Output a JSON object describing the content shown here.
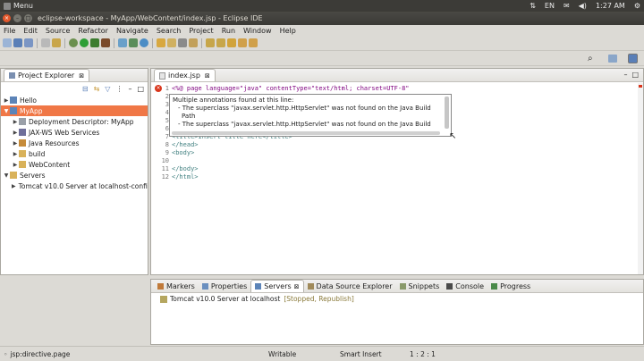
{
  "system": {
    "menu": "Menu",
    "keyboard": "EN",
    "clock": "1:27 AM"
  },
  "window": {
    "title": "eclipse-workspace - MyApp/WebContent/index.jsp - Eclipse IDE"
  },
  "menubar": [
    "File",
    "Edit",
    "Source",
    "Refactor",
    "Navigate",
    "Search",
    "Project",
    "Run",
    "Window",
    "Help"
  ],
  "explorer": {
    "tab": "Project Explorer",
    "items": [
      {
        "label": "Hello",
        "depth": 0,
        "expanded": false,
        "selected": false,
        "icon": "project-icon"
      },
      {
        "label": "MyApp",
        "depth": 0,
        "expanded": true,
        "selected": true,
        "icon": "project-icon"
      },
      {
        "label": "Deployment Descriptor: MyApp",
        "depth": 1,
        "expanded": false,
        "selected": false,
        "icon": "descriptor-icon"
      },
      {
        "label": "JAX-WS Web Services",
        "depth": 1,
        "expanded": false,
        "selected": false,
        "icon": "webservice-icon"
      },
      {
        "label": "Java Resources",
        "depth": 1,
        "expanded": false,
        "selected": false,
        "icon": "java-resources-icon"
      },
      {
        "label": "build",
        "depth": 1,
        "expanded": false,
        "selected": false,
        "icon": "folder-icon"
      },
      {
        "label": "WebContent",
        "depth": 1,
        "expanded": false,
        "selected": false,
        "icon": "folder-icon"
      },
      {
        "label": "Servers",
        "depth": 0,
        "expanded": true,
        "selected": false,
        "icon": "folder-icon"
      },
      {
        "label": "Tomcat v10.0 Server at localhost-config",
        "depth": 1,
        "expanded": false,
        "selected": false,
        "icon": "folder-icon"
      }
    ]
  },
  "editor": {
    "tab": "index.jsp",
    "lines": [
      {
        "n": "1",
        "text": "<%@ page language=\"java\" contentType=\"text/html; charset=UTF-8\""
      },
      {
        "n": "2",
        "text": ""
      },
      {
        "n": "3",
        "text": ""
      },
      {
        "n": "4",
        "text": ""
      },
      {
        "n": "5",
        "text": ""
      },
      {
        "n": "6",
        "text": ""
      },
      {
        "n": "7",
        "text": "<title>Insert title here</title>"
      },
      {
        "n": "8",
        "text": "</head>"
      },
      {
        "n": "9",
        "text": "<body>"
      },
      {
        "n": "10",
        "text": ""
      },
      {
        "n": "11",
        "text": "</body>"
      },
      {
        "n": "12",
        "text": "</html>"
      }
    ],
    "hover": {
      "title": "Multiple annotations found at this line:",
      "items": [
        "- The superclass \"javax.servlet.http.HttpServlet\" was not found on the Java Build",
        "Path",
        "- The superclass \"javax.servlet.http.HttpServlet\" was not found on the Java Build"
      ]
    }
  },
  "bottom": {
    "tabs": [
      "Markers",
      "Properties",
      "Servers",
      "Data Source Explorer",
      "Snippets",
      "Console",
      "Progress"
    ],
    "active": "Servers",
    "server": {
      "name": "Tomcat v10.0 Server at localhost",
      "state": "[Stopped, Republish]"
    }
  },
  "status": {
    "path": "jsp:directive.page",
    "mode": "Writable",
    "insert": "Smart Insert",
    "pos": "1 : 2 : 1"
  },
  "colors": {
    "selection": "#f07746",
    "error": "#d9361c"
  }
}
